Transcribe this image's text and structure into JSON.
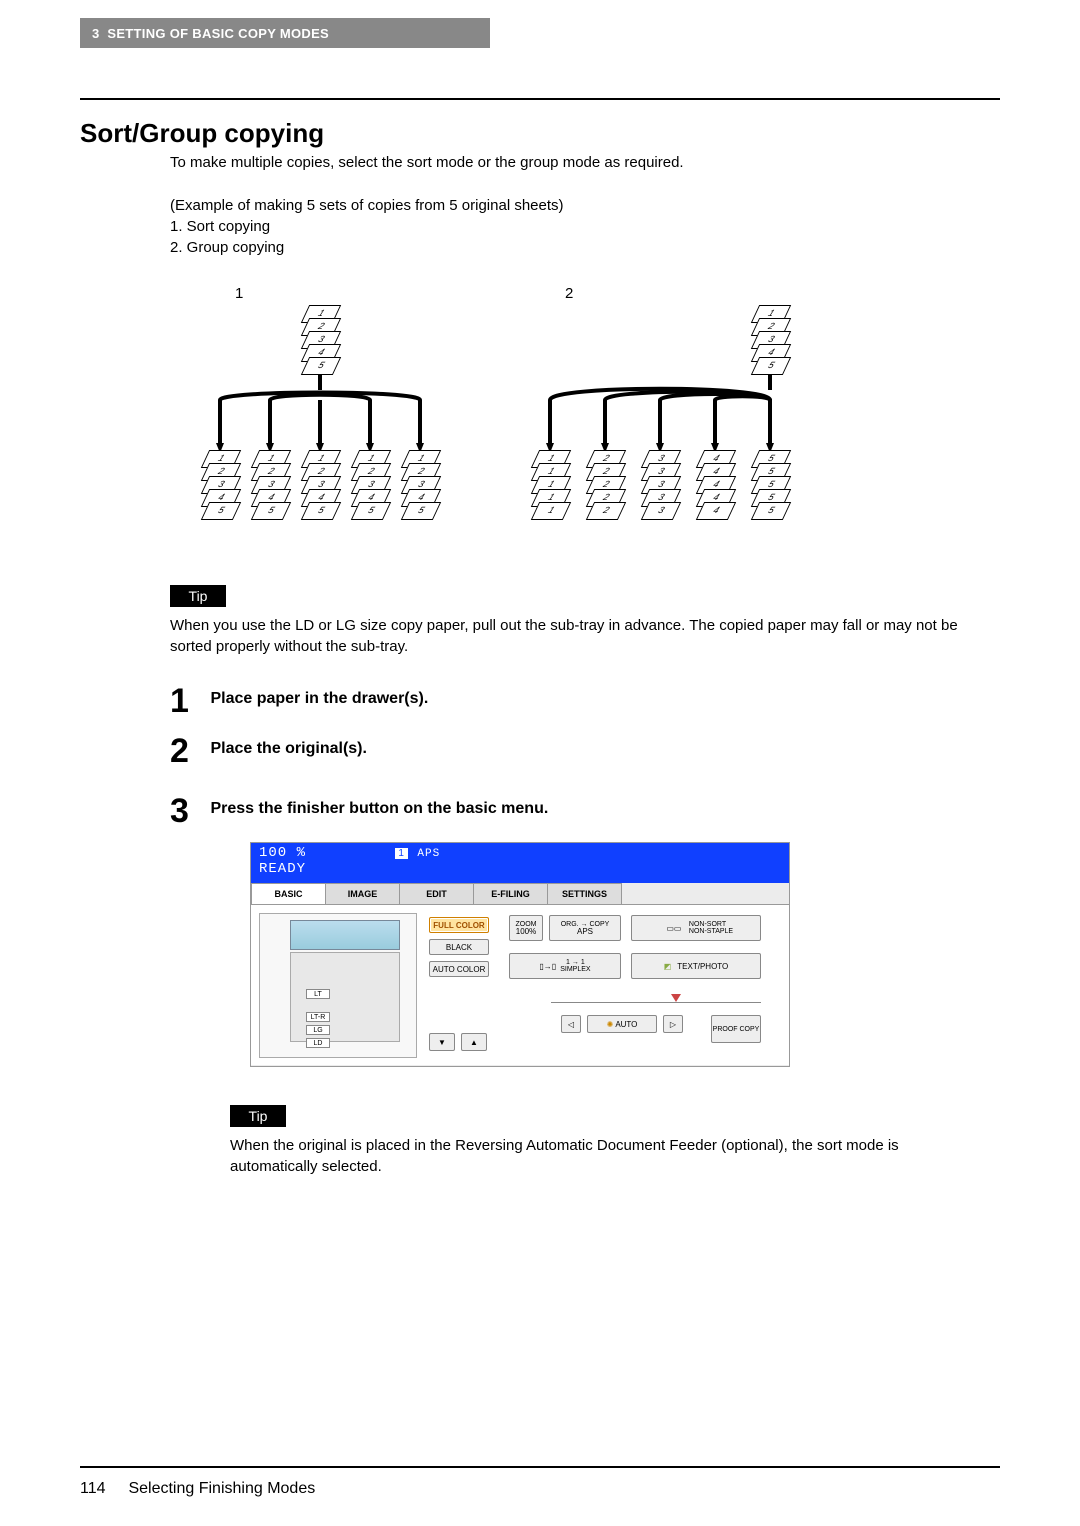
{
  "header": {
    "chapter_num": "3",
    "chapter_title": "SETTING OF BASIC COPY MODES"
  },
  "title": "Sort/Group copying",
  "intro": "To make multiple copies, select the sort mode or the group mode as required.",
  "example": {
    "lead": "(Example of making 5 sets of copies from 5 original sheets)",
    "items": [
      "1.  Sort copying",
      "2.  Group copying"
    ]
  },
  "diagram": {
    "label_left": "1",
    "label_right": "2",
    "original_pages": [
      "1",
      "2",
      "3",
      "4",
      "5"
    ],
    "sort_outputs": [
      [
        "1",
        "2",
        "3",
        "4",
        "5"
      ],
      [
        "1",
        "2",
        "3",
        "4",
        "5"
      ],
      [
        "1",
        "2",
        "3",
        "4",
        "5"
      ],
      [
        "1",
        "2",
        "3",
        "4",
        "5"
      ],
      [
        "1",
        "2",
        "3",
        "4",
        "5"
      ]
    ],
    "group_outputs": [
      [
        "1",
        "1",
        "1",
        "1",
        "1"
      ],
      [
        "2",
        "2",
        "2",
        "2",
        "2"
      ],
      [
        "3",
        "3",
        "3",
        "3",
        "3"
      ],
      [
        "4",
        "4",
        "4",
        "4",
        "4"
      ],
      [
        "5",
        "5",
        "5",
        "5",
        "5"
      ]
    ]
  },
  "tips": {
    "label": "Tip",
    "text1": "When you use the LD or LG size copy paper, pull out the sub-tray in advance. The copied paper may fall or may not be sorted properly without the sub-tray.",
    "text2": "When the original is placed in the Reversing Automatic Document Feeder (optional), the sort mode is automatically selected."
  },
  "steps": [
    {
      "num": "1",
      "text": "Place paper in the drawer(s)."
    },
    {
      "num": "2",
      "text": "Place the original(s)."
    },
    {
      "num": "3",
      "text": "Press the finisher button on the basic menu."
    }
  ],
  "panel": {
    "zoom_pct": "100  %",
    "count": "1",
    "aps": "APS",
    "status": "READY",
    "tabs": [
      "BASIC",
      "IMAGE",
      "EDIT",
      "E-FILING",
      "SETTINGS"
    ],
    "active_tab": 0,
    "drawers": [
      "LT",
      "LT-R",
      "LG",
      "LD"
    ],
    "color_modes": [
      "FULL COLOR",
      "BLACK",
      "AUTO COLOR"
    ],
    "zoom": {
      "label": "ZOOM",
      "value": "100%"
    },
    "orig_copy": {
      "label": "ORG. → COPY",
      "value": "APS"
    },
    "finisher": {
      "line1": "NON-SORT",
      "line2": "NON-STAPLE"
    },
    "duplex": {
      "label": "SIMPLEX",
      "mode": "1 → 1"
    },
    "img_mode": "TEXT/PHOTO",
    "density": "AUTO",
    "proof": "PROOF COPY",
    "arrow_down": "▼",
    "arrow_up": "▲",
    "arrow_left": "◁",
    "arrow_right": "▷"
  },
  "footer": {
    "page": "114",
    "section": "Selecting Finishing Modes"
  }
}
